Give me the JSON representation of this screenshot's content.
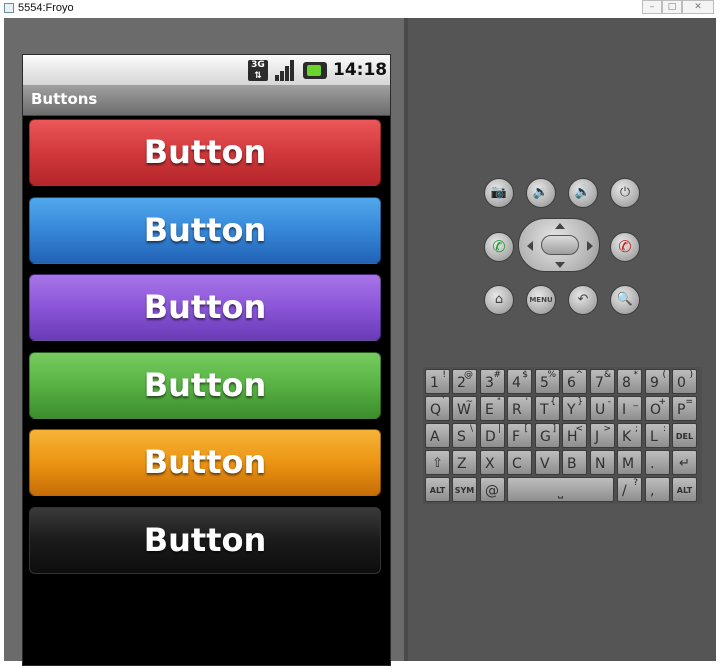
{
  "window": {
    "title": "5554:Froyo",
    "minimize_icon": "minimize-icon",
    "maximize_icon": "maximize-icon",
    "close_icon": "close-icon"
  },
  "status_bar": {
    "network": "3G",
    "time": "14:18",
    "icons": [
      "3g-icon",
      "signal-icon",
      "battery-charging-icon"
    ]
  },
  "app": {
    "title": "Buttons"
  },
  "buttons": [
    {
      "label": "Button",
      "color": "#d1393c"
    },
    {
      "label": "Button",
      "color": "#3687d8"
    },
    {
      "label": "Button",
      "color": "#8a55d8"
    },
    {
      "label": "Button",
      "color": "#58b243"
    },
    {
      "label": "Button",
      "color": "#ec9412"
    },
    {
      "label": "Button",
      "color": "#1a1a1a"
    }
  ],
  "controls": {
    "row1": [
      "camera-icon",
      "volume-down-icon",
      "volume-up-icon",
      "power-icon"
    ],
    "row2": [
      "call-icon",
      "dpad",
      "end-call-icon"
    ],
    "row3": [
      "home-icon",
      "menu-button",
      "back-icon",
      "search-icon"
    ],
    "menu_label": "MENU"
  },
  "keyboard": {
    "row1": [
      [
        "1",
        "!"
      ],
      [
        "2",
        "@"
      ],
      [
        "3",
        "#"
      ],
      [
        "4",
        "$"
      ],
      [
        "5",
        "%"
      ],
      [
        "6",
        "^"
      ],
      [
        "7",
        "&"
      ],
      [
        "8",
        "*"
      ],
      [
        "9",
        "("
      ],
      [
        "0",
        ")"
      ]
    ],
    "row2": [
      [
        "Q",
        "`"
      ],
      [
        "W",
        "~"
      ],
      [
        "E",
        "\""
      ],
      [
        "R",
        "'"
      ],
      [
        "T",
        "{"
      ],
      [
        "Y",
        "}"
      ],
      [
        "U",
        "-"
      ],
      [
        "I",
        "_"
      ],
      [
        "O",
        "+"
      ],
      [
        "P",
        "="
      ]
    ],
    "row3": [
      [
        "A",
        ""
      ],
      [
        "S",
        "\\"
      ],
      [
        "D",
        "|"
      ],
      [
        "F",
        "["
      ],
      [
        "G",
        "]"
      ],
      [
        "H",
        "<"
      ],
      [
        "J",
        ">"
      ],
      [
        "K",
        ";"
      ],
      [
        "L",
        ":"
      ],
      [
        "DEL",
        ""
      ]
    ],
    "row4": [
      "Z",
      "X",
      "C",
      "V",
      "B",
      "N",
      "M",
      "."
    ],
    "row5": {
      "alt_left": "ALT",
      "sym": "SYM",
      "at": "@",
      "slash": "/",
      "question": "?",
      "comma": ",",
      "alt_right": "ALT"
    }
  }
}
